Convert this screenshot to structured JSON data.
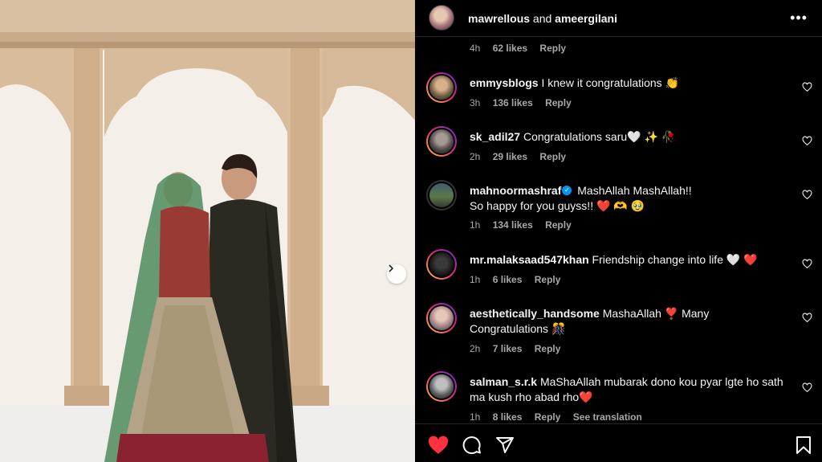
{
  "post": {
    "author": "mawrellous",
    "and_text": "and",
    "collaborator": "ameergilani",
    "prev_comment": {
      "time": "4h",
      "likes": "62 likes",
      "reply": "Reply"
    }
  },
  "comments": [
    {
      "user": "emmysblogs",
      "text": "I knew it congratulations 👏",
      "time": "3h",
      "likes": "136 likes",
      "reply": "Reply"
    },
    {
      "user": "sk_adil27",
      "text": "Congratulations saru🤍 ✨ 🥀",
      "time": "2h",
      "likes": "29 likes",
      "reply": "Reply"
    },
    {
      "user": "mahnoormashraf",
      "text_line1": "MashAllah MashAllah!!",
      "text_line2": "So happy for you guyss!! ❤️ 🫶 🥹",
      "time": "1h",
      "likes": "134 likes",
      "reply": "Reply"
    },
    {
      "user": "mr.malaksaad547khan",
      "text": "Friendship change into life 🤍 ❤️",
      "time": "1h",
      "likes": "6 likes",
      "reply": "Reply"
    },
    {
      "user": "aesthetically_handsome",
      "text": "MashaAllah ❣️  Many Congratulations 🎊",
      "time": "2h",
      "likes": "7 likes",
      "reply": "Reply"
    },
    {
      "user": "salman_s.r.k",
      "text": "MaShaAllah mubarak dono kou pyar lgte ho sath ma kush rho abad rho❤️",
      "time": "1h",
      "likes": "8 likes",
      "reply": "Reply",
      "translate": "See translation"
    }
  ],
  "icons": {
    "more": "more-options-icon",
    "like": "heart-filled-icon",
    "comment": "comment-icon",
    "share": "share-icon",
    "save": "bookmark-icon",
    "next": "chevron-right-icon"
  },
  "colors": {
    "like_red": "#ff3040",
    "muted": "#a8a8a8"
  }
}
